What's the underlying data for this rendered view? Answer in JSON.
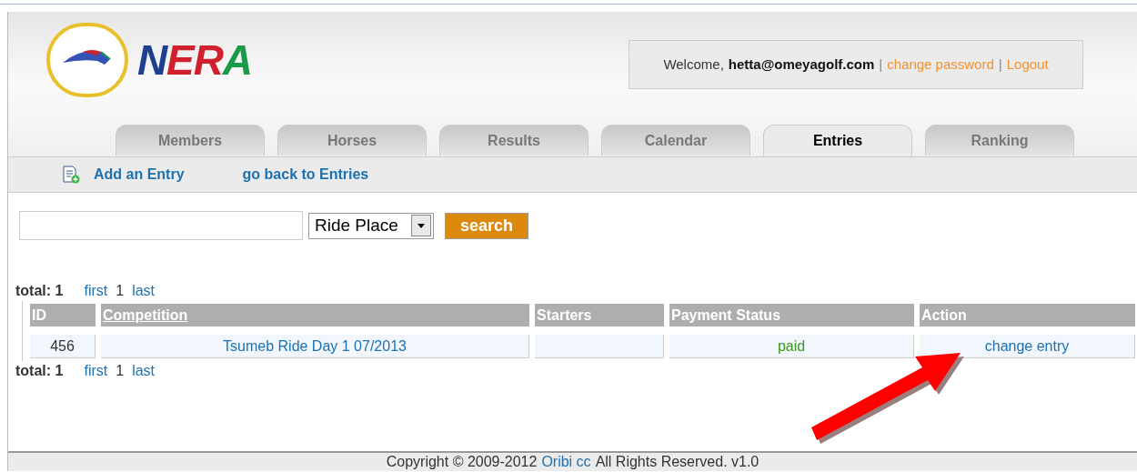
{
  "logo": {
    "letters": [
      {
        "text": "N",
        "color": "#1c3f8f"
      },
      {
        "text": "E",
        "color": "#d0202e"
      },
      {
        "text": "R",
        "color": "#d0202e"
      },
      {
        "text": "A",
        "color": "#1b9a48"
      }
    ]
  },
  "account": {
    "greeting": "Welcome,",
    "user": "hetta@omeyagolf.com",
    "separator": "|",
    "links": [
      "change password",
      "Logout"
    ]
  },
  "tabs": [
    {
      "label": "Members",
      "selected": false
    },
    {
      "label": "Horses",
      "selected": false
    },
    {
      "label": "Results",
      "selected": false
    },
    {
      "label": "Calendar",
      "selected": false
    },
    {
      "label": "Entries",
      "selected": true
    },
    {
      "label": "Ranking",
      "selected": false
    }
  ],
  "subnav": [
    {
      "label": "Add an Entry",
      "kind": "icon"
    },
    {
      "label": "go back to Entries",
      "kind": "plain"
    }
  ],
  "search": {
    "select": "Ride Place",
    "button": "search"
  },
  "pagination": [
    {
      "total_label": "total:",
      "total": "1",
      "links": [
        "first",
        "1",
        "last"
      ]
    },
    {
      "total_label": "total:",
      "total": "1",
      "links": [
        "first",
        "1",
        "last"
      ]
    }
  ],
  "table": {
    "columns": [
      {
        "label": "ID",
        "sortable": false
      },
      {
        "label": "Competition",
        "sortable": true
      },
      {
        "label": "Starters",
        "sortable": false
      },
      {
        "label": "Payment Status",
        "sortable": false
      },
      {
        "label": "Action",
        "sortable": false
      }
    ],
    "rows": [
      {
        "id": "456",
        "competition": "Tsumeb Ride Day 1 07/2013",
        "starters": "",
        "payment_status": "paid",
        "action": "change entry"
      }
    ]
  },
  "footer": {
    "text_before": "Copyright © 2009-2012",
    "link": "Oribi cc",
    "text_after": "All Rights Reserved. v1.0"
  }
}
